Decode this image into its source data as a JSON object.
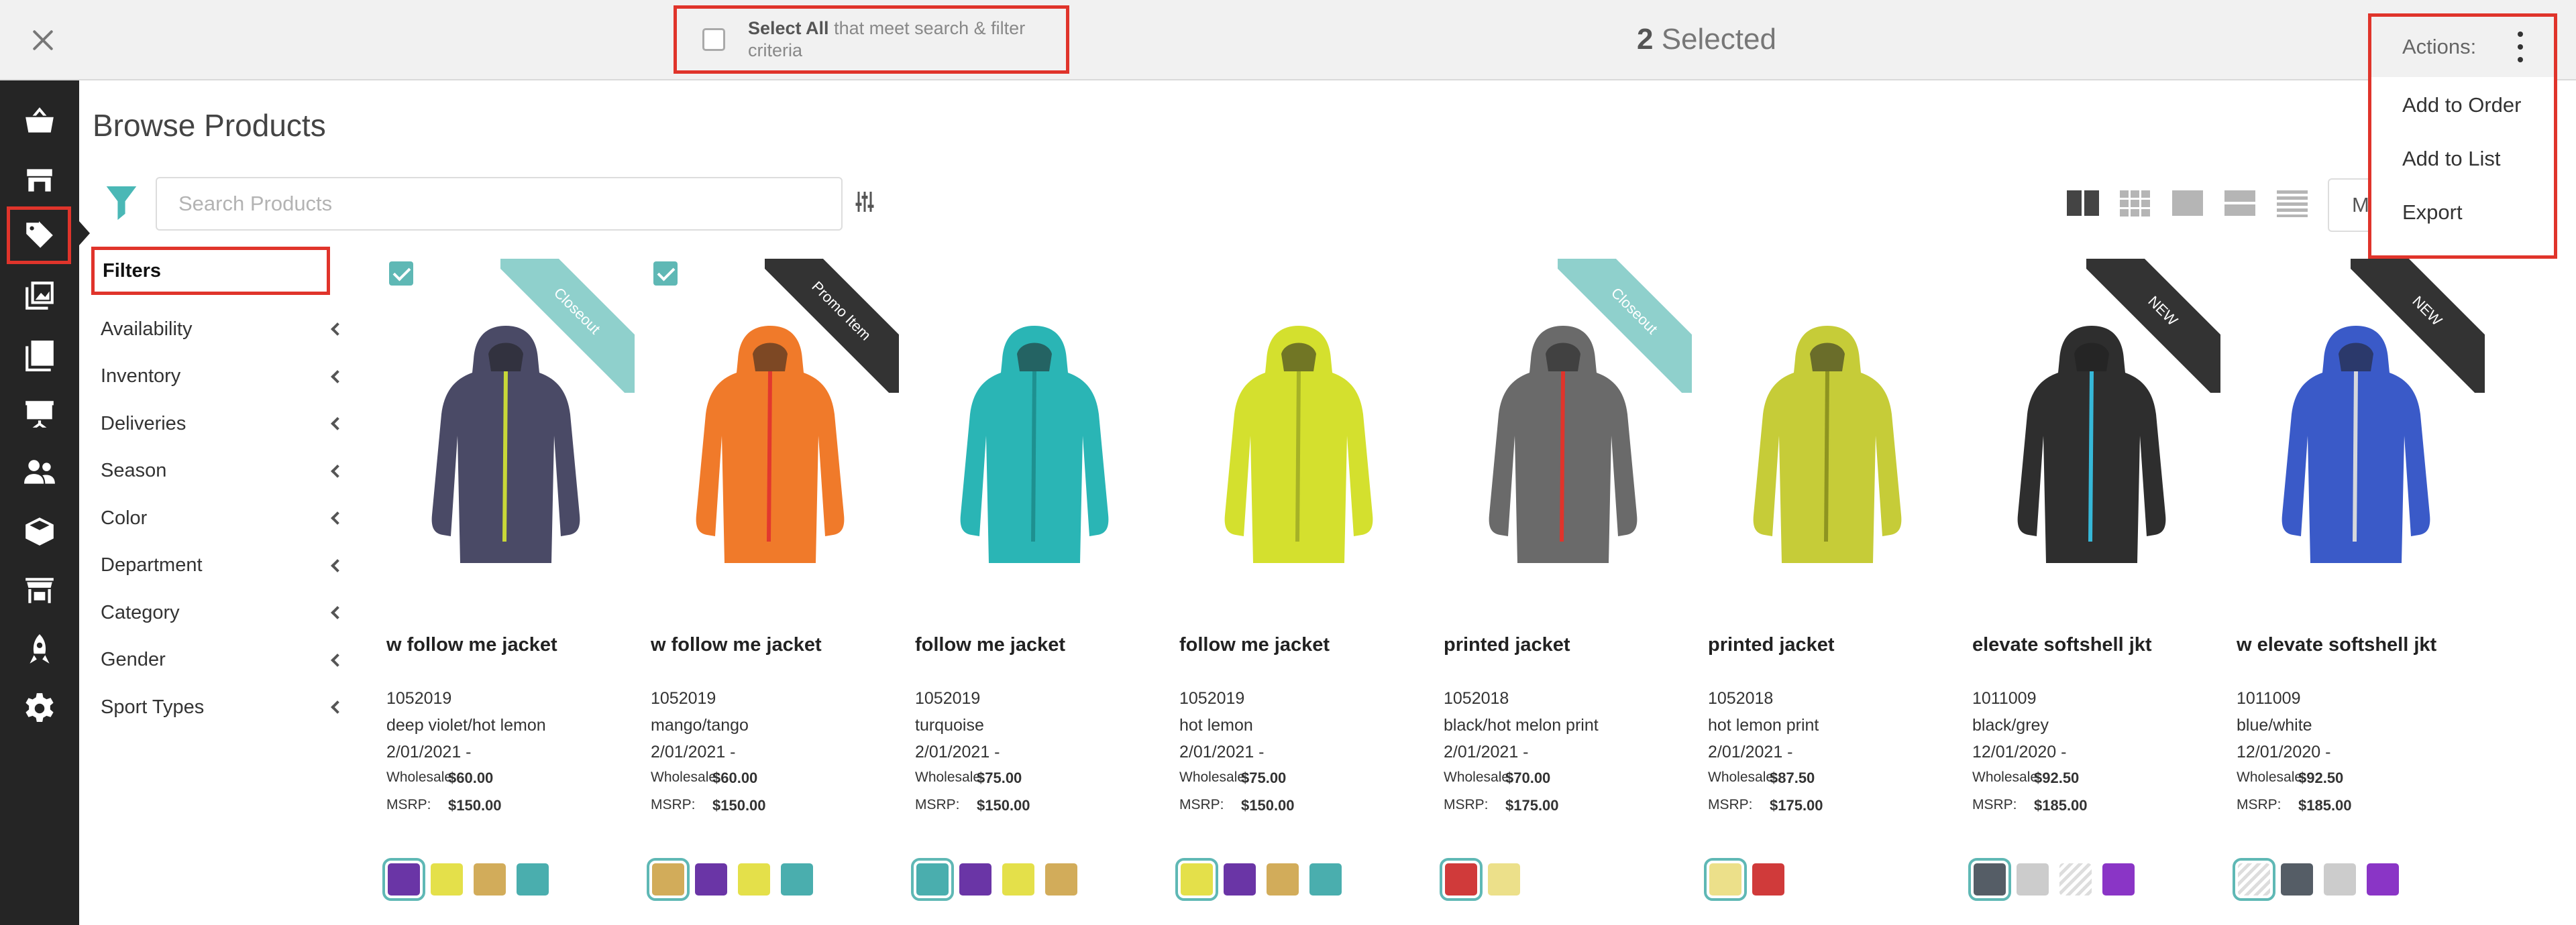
{
  "topbar": {
    "select_all_bold": "Select All",
    "select_all_rest": " that meet search & filter criteria",
    "selected_count": "2",
    "selected_label": " Selected",
    "actions_label": "Actions:",
    "menu": [
      "Add to Order",
      "Add to List",
      "Export"
    ]
  },
  "sidebar": {
    "icons": [
      "basket-icon",
      "store-icon",
      "tag-icon",
      "gallery-icon",
      "catalog-icon",
      "presentation-icon",
      "users-icon",
      "boxes-icon",
      "shop-stand-icon",
      "rocket-icon",
      "gear-icon"
    ],
    "active": "tag-icon"
  },
  "header": {
    "title": "Browse Products",
    "search_placeholder": "Search Products",
    "sort_visible": "M"
  },
  "filters": {
    "title": "Filters",
    "items": [
      "Availability",
      "Inventory",
      "Deliveries",
      "Season",
      "Color",
      "Department",
      "Category",
      "Gender",
      "Sport Types"
    ]
  },
  "labels": {
    "wholesale": "Wholesale:",
    "msrp": "MSRP:"
  },
  "products": [
    {
      "name": "w follow me jacket",
      "number": "1052019",
      "color": "deep violet/hot lemon",
      "date": "2/01/2021 -",
      "wholesale": "$60.00",
      "msrp": "$150.00",
      "checked": true,
      "ribbon": "Closeout",
      "ribbon_style": "teal",
      "body": "#4a4a66",
      "accent": "#c8d838",
      "swatches": [
        "#6a35a6",
        "#e4e04a",
        "#d2ac5a",
        "#4aaeae"
      ],
      "selected_swatch": 0
    },
    {
      "name": "w follow me jacket",
      "number": "1052019",
      "color": "mango/tango",
      "date": "2/01/2021 -",
      "wholesale": "$60.00",
      "msrp": "$150.00",
      "checked": true,
      "ribbon": "Promo Item",
      "ribbon_style": "dark",
      "body": "#f07a2a",
      "accent": "#e2382e",
      "swatches": [
        "#d2ac5a",
        "#6a35a6",
        "#e4e04a",
        "#4aaeae"
      ],
      "selected_swatch": 0
    },
    {
      "name": "follow me jacket",
      "number": "1052019",
      "color": "turquoise",
      "date": "2/01/2021 -",
      "wholesale": "$75.00",
      "msrp": "$150.00",
      "checked": false,
      "ribbon": "",
      "ribbon_style": "",
      "body": "#2ab5b5",
      "accent": "#1e9090",
      "swatches": [
        "#4aaeae",
        "#6a35a6",
        "#e4e04a",
        "#d2ac5a"
      ],
      "selected_swatch": 0
    },
    {
      "name": "follow me jacket",
      "number": "1052019",
      "color": "hot lemon",
      "date": "2/01/2021 -",
      "wholesale": "$75.00",
      "msrp": "$150.00",
      "checked": false,
      "ribbon": "",
      "ribbon_style": "",
      "body": "#d4e02e",
      "accent": "#a6b226",
      "swatches": [
        "#e4e04a",
        "#6a35a6",
        "#d2ac5a",
        "#4aaeae"
      ],
      "selected_swatch": 0
    },
    {
      "name": "printed jacket",
      "number": "1052018",
      "color": "black/hot melon print",
      "date": "2/01/2021 -",
      "wholesale": "$70.00",
      "msrp": "$175.00",
      "checked": false,
      "ribbon": "Closeout",
      "ribbon_style": "teal",
      "body": "#6a6a6a",
      "accent": "#e0342b",
      "swatches": [
        "#d03a3a",
        "#ece08a"
      ],
      "selected_swatch": 0
    },
    {
      "name": "printed jacket",
      "number": "1052018",
      "color": "hot lemon print",
      "date": "2/01/2021 -",
      "wholesale": "$87.50",
      "msrp": "$175.00",
      "checked": false,
      "ribbon": "",
      "ribbon_style": "",
      "body": "#c6cc38",
      "accent": "#8e9420",
      "swatches": [
        "#ece08a",
        "#d03a3a"
      ],
      "selected_swatch": 0
    },
    {
      "name": "elevate softshell jkt",
      "number": "1011009",
      "color": "black/grey",
      "date": "12/01/2020 -",
      "wholesale": "$92.50",
      "msrp": "$185.00",
      "checked": false,
      "ribbon": "NEW",
      "ribbon_style": "dark",
      "body": "#2e2e2e",
      "accent": "#36b8d8",
      "swatches": [
        "#555d66",
        "#cccccc",
        "hatch",
        "#8a35c6"
      ],
      "selected_swatch": 0
    },
    {
      "name": "w elevate softshell jkt",
      "number": "1011009",
      "color": "blue/white",
      "date": "12/01/2020 -",
      "wholesale": "$92.50",
      "msrp": "$185.00",
      "checked": false,
      "ribbon": "NEW",
      "ribbon_style": "dark",
      "body": "#3a5ac8",
      "accent": "#d6d8dc",
      "swatches": [
        "hatch",
        "#555d66",
        "#cccccc",
        "#8a35c6"
      ],
      "selected_swatch": 0
    }
  ]
}
